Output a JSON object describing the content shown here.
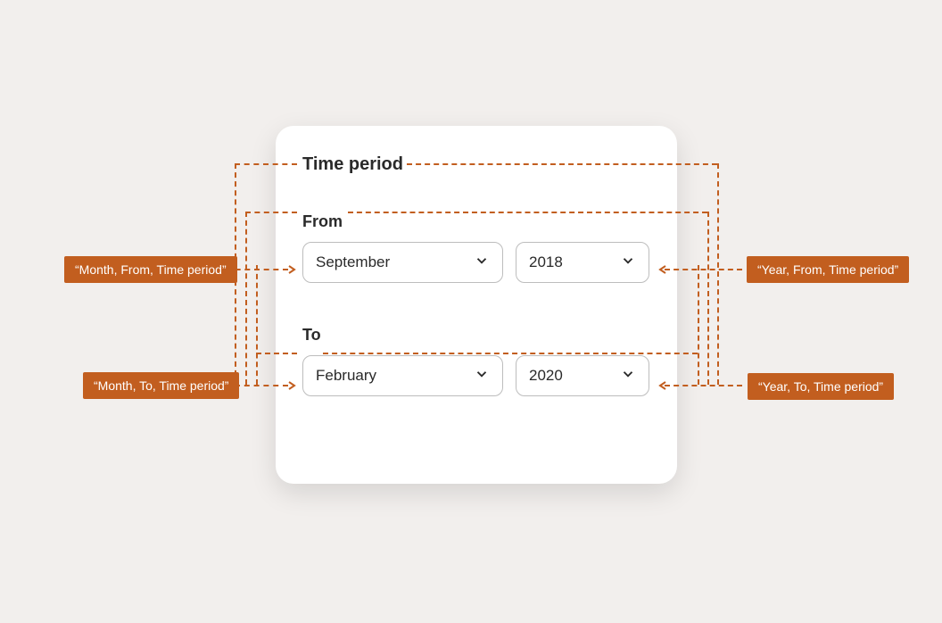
{
  "card": {
    "title": "Time period",
    "from": {
      "label": "From",
      "month": "September",
      "year": "2018"
    },
    "to": {
      "label": "To",
      "month": "February",
      "year": "2020"
    }
  },
  "annotations": {
    "topLeft": "“Month, From, Time period”",
    "bottomLeft": "“Month, To, Time period”",
    "topRight": "“Year, From, Time period”",
    "bottomRight": "“Year, To, Time period”"
  }
}
